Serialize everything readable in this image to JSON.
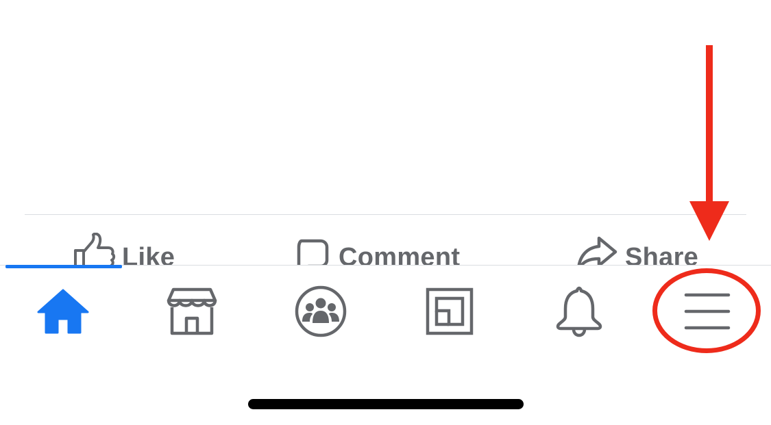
{
  "post_actions": {
    "like_label": "Like",
    "comment_label": "Comment",
    "share_label": "Share"
  },
  "icons": {
    "like": "thumbs-up-icon",
    "comment": "comment-bubble-icon",
    "share": "share-arrow-icon",
    "home": "home-icon",
    "marketplace": "marketplace-store-icon",
    "groups": "groups-icon",
    "gaming": "gaming-icon",
    "notifications": "bell-icon",
    "menu": "hamburger-menu-icon"
  },
  "tab_bar": {
    "active_tab": "home"
  },
  "colors": {
    "active": "#1877f2",
    "inactive": "#65676b",
    "annotation": "#ee2b1b",
    "divider": "#dadde1"
  }
}
